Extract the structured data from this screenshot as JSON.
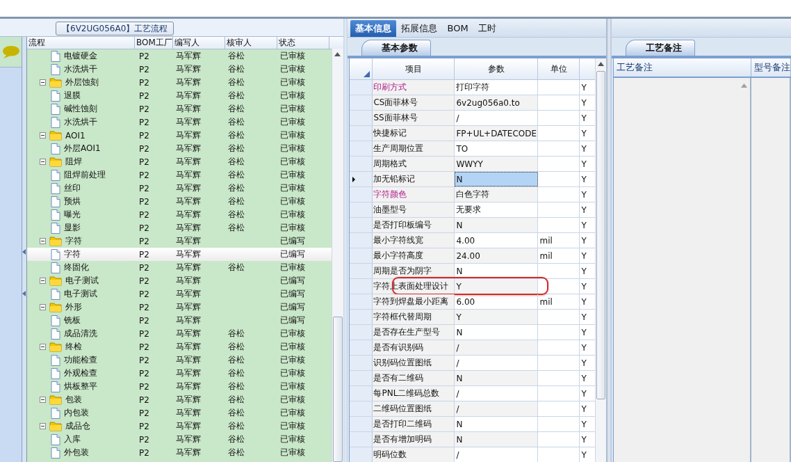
{
  "flow_panel": {
    "title": "【6V2UG056A0】工艺流程",
    "columns": [
      "流程",
      "BOM工厂",
      "编写人",
      "核审人",
      "状态"
    ],
    "rows": [
      {
        "children": [
          {
            "name": "电镀硬金",
            "factory": "P2",
            "writer": "马军辉",
            "reviewer": "谷松",
            "status": "已审核",
            "selected": false
          },
          {
            "name": "水洗烘干",
            "factory": "P2",
            "writer": "马军辉",
            "reviewer": "谷松",
            "status": "已审核",
            "selected": false
          }
        ]
      },
      {
        "name": "外层蚀刻",
        "factory": "P2",
        "writer": "马军辉",
        "reviewer": "谷松",
        "status": "已审核",
        "selected": false,
        "expanded": true,
        "children": [
          {
            "name": "退膜",
            "factory": "P2",
            "writer": "马军辉",
            "reviewer": "谷松",
            "status": "已审核",
            "selected": false
          },
          {
            "name": "碱性蚀刻",
            "factory": "P2",
            "writer": "马军辉",
            "reviewer": "谷松",
            "status": "已审核",
            "selected": false
          },
          {
            "name": "水洗烘干",
            "factory": "P2",
            "writer": "马军辉",
            "reviewer": "谷松",
            "status": "已审核",
            "selected": false
          }
        ]
      },
      {
        "name": "AOI1",
        "factory": "P2",
        "writer": "马军辉",
        "reviewer": "谷松",
        "status": "已审核",
        "selected": false,
        "expanded": true,
        "children": [
          {
            "name": "外层AOI1",
            "factory": "P2",
            "writer": "马军辉",
            "reviewer": "谷松",
            "status": "已审核",
            "selected": false
          }
        ]
      },
      {
        "name": "阻焊",
        "factory": "P2",
        "writer": "马军辉",
        "reviewer": "谷松",
        "status": "已审核",
        "selected": false,
        "expanded": true,
        "children": [
          {
            "name": "阻焊前处理",
            "factory": "P2",
            "writer": "马军辉",
            "reviewer": "谷松",
            "status": "已审核",
            "selected": false
          },
          {
            "name": "丝印",
            "factory": "P2",
            "writer": "马军辉",
            "reviewer": "谷松",
            "status": "已审核",
            "selected": false
          },
          {
            "name": "预烘",
            "factory": "P2",
            "writer": "马军辉",
            "reviewer": "谷松",
            "status": "已审核",
            "selected": false
          },
          {
            "name": "曝光",
            "factory": "P2",
            "writer": "马军辉",
            "reviewer": "谷松",
            "status": "已审核",
            "selected": false
          },
          {
            "name": "显影",
            "factory": "P2",
            "writer": "马军辉",
            "reviewer": "谷松",
            "status": "已审核",
            "selected": false
          }
        ]
      },
      {
        "name": "字符",
        "factory": "P2",
        "writer": "马军辉",
        "status": "已编写",
        "selected": false,
        "expanded": true,
        "children": [
          {
            "name": "字符",
            "factory": "P2",
            "writer": "马军辉",
            "status": "已编写",
            "selected": true
          },
          {
            "name": "终固化",
            "factory": "P2",
            "writer": "马军辉",
            "reviewer": "谷松",
            "status": "已审核",
            "selected": false
          }
        ]
      },
      {
        "name": "电子测试",
        "factory": "P2",
        "writer": "马军辉",
        "status": "已编写",
        "selected": false,
        "expanded": true,
        "children": [
          {
            "name": "电子测试",
            "factory": "P2",
            "writer": "马军辉",
            "status": "已编写",
            "selected": false
          }
        ]
      },
      {
        "name": "外形",
        "factory": "P2",
        "writer": "马军辉",
        "status": "已编写",
        "selected": false,
        "expanded": true,
        "children": [
          {
            "name": "铣板",
            "factory": "P2",
            "writer": "马军辉",
            "status": "已编写",
            "selected": false
          },
          {
            "name": "成品清洗",
            "factory": "P2",
            "writer": "马军辉",
            "reviewer": "谷松",
            "status": "已审核",
            "selected": false
          }
        ]
      },
      {
        "name": "终检",
        "factory": "P2",
        "writer": "马军辉",
        "reviewer": "谷松",
        "status": "已审核",
        "selected": false,
        "expanded": true,
        "children": [
          {
            "name": "功能检查",
            "factory": "P2",
            "writer": "马军辉",
            "reviewer": "谷松",
            "status": "已审核",
            "selected": false
          },
          {
            "name": "外观检查",
            "factory": "P2",
            "writer": "马军辉",
            "reviewer": "谷松",
            "status": "已审核",
            "selected": false
          },
          {
            "name": "烘板整平",
            "factory": "P2",
            "writer": "马军辉",
            "reviewer": "谷松",
            "status": "已审核",
            "selected": false
          }
        ]
      },
      {
        "name": "包装",
        "factory": "P2",
        "writer": "马军辉",
        "reviewer": "谷松",
        "status": "已审核",
        "selected": false,
        "expanded": true,
        "children": [
          {
            "name": "内包装",
            "factory": "P2",
            "writer": "马军辉",
            "reviewer": "谷松",
            "status": "已审核",
            "selected": false
          }
        ]
      },
      {
        "name": "成品仓",
        "factory": "P2",
        "writer": "马军辉",
        "reviewer": "谷松",
        "status": "已审核",
        "selected": false,
        "expanded": true,
        "children": [
          {
            "name": "入库",
            "factory": "P2",
            "writer": "马军辉",
            "reviewer": "谷松",
            "status": "已审核",
            "selected": false
          },
          {
            "name": "外包装",
            "factory": "P2",
            "writer": "马军辉",
            "reviewer": "谷松",
            "status": "已审核",
            "selected": false
          }
        ]
      }
    ]
  },
  "tabs": [
    {
      "label": "基本信息",
      "selected": true
    },
    {
      "label": "拓展信息",
      "selected": false
    },
    {
      "label": "BOM",
      "selected": false
    },
    {
      "label": "工时",
      "selected": false
    }
  ],
  "sub_tab": "基本参数",
  "param_grid": {
    "columns": [
      "项目",
      "参数",
      "单位"
    ],
    "rows": [
      {
        "item": "印刷方式",
        "value": "打印字符",
        "column_4": "Y",
        "highlight": true,
        "selected": false
      },
      {
        "item": "CS面菲林号",
        "value": "6v2ug056a0.to",
        "column_4": "Y",
        "selected": false
      },
      {
        "item": "SS面菲林号",
        "value": "/",
        "column_4": "Y",
        "selected": false
      },
      {
        "item": "快捷标记",
        "value": "FP+UL+DATECODE",
        "column_4": "Y",
        "selected": false
      },
      {
        "item": "生产周期位置",
        "value": "TO",
        "column_4": "Y",
        "selected": false
      },
      {
        "item": "周期格式",
        "value": "WWYY",
        "column_4": "Y",
        "selected": false
      },
      {
        "item": "加无铅标记",
        "value": "N",
        "column_4": "Y",
        "selected": true
      },
      {
        "item": "字符颜色",
        "value": "白色字符",
        "column_4": "Y",
        "highlight": true,
        "selected": false
      },
      {
        "item": "油墨型号",
        "value": "无要求",
        "column_4": "Y",
        "selected": false
      },
      {
        "item": "是否打印板编号",
        "value": "N",
        "column_4": "Y",
        "selected": false
      },
      {
        "item": "最小字符线宽",
        "value": "4.00",
        "unit": "mil",
        "column_4": "Y",
        "selected": false
      },
      {
        "item": "最小字符高度",
        "value": "24.00",
        "unit": "mil",
        "column_4": "Y",
        "selected": false
      },
      {
        "item": "周期是否为阴字",
        "value": "N",
        "column_4": "Y",
        "selected": false
      },
      {
        "item": "字符上表面处理设计",
        "value": "Y",
        "column_4": "Y",
        "circled": true,
        "selected": false
      },
      {
        "item": "字符到焊盘最小距离",
        "value": "6.00",
        "unit": "mil",
        "column_4": "Y",
        "selected": false
      },
      {
        "item": "字符框代替周期",
        "value": "Y",
        "column_4": "Y",
        "selected": false
      },
      {
        "item": "是否存在生产型号",
        "value": "N",
        "column_4": "Y",
        "selected": false
      },
      {
        "item": "是否有识别码",
        "value": "/",
        "column_4": "Y",
        "selected": false
      },
      {
        "item": "识别码位置图纸",
        "value": "/",
        "column_4": "Y",
        "selected": false
      },
      {
        "item": "是否有二维码",
        "value": "N",
        "column_4": "Y",
        "selected": false
      },
      {
        "item": "每PNL二维码总数",
        "value": "/",
        "column_4": "Y",
        "selected": false
      },
      {
        "item": "二维码位置图纸",
        "value": "/",
        "column_4": "Y",
        "selected": false
      },
      {
        "item": "是否打印二维码",
        "value": "N",
        "column_4": "Y",
        "selected": false
      },
      {
        "item": "是否有增加明码",
        "value": "N",
        "column_4": "Y",
        "selected": false
      },
      {
        "item": "明码位数",
        "value": "/",
        "column_4": "Y",
        "selected": false
      }
    ]
  },
  "notes_panel": {
    "tab": "工艺备注",
    "columns": [
      "工艺备注",
      "型号备注"
    ]
  }
}
